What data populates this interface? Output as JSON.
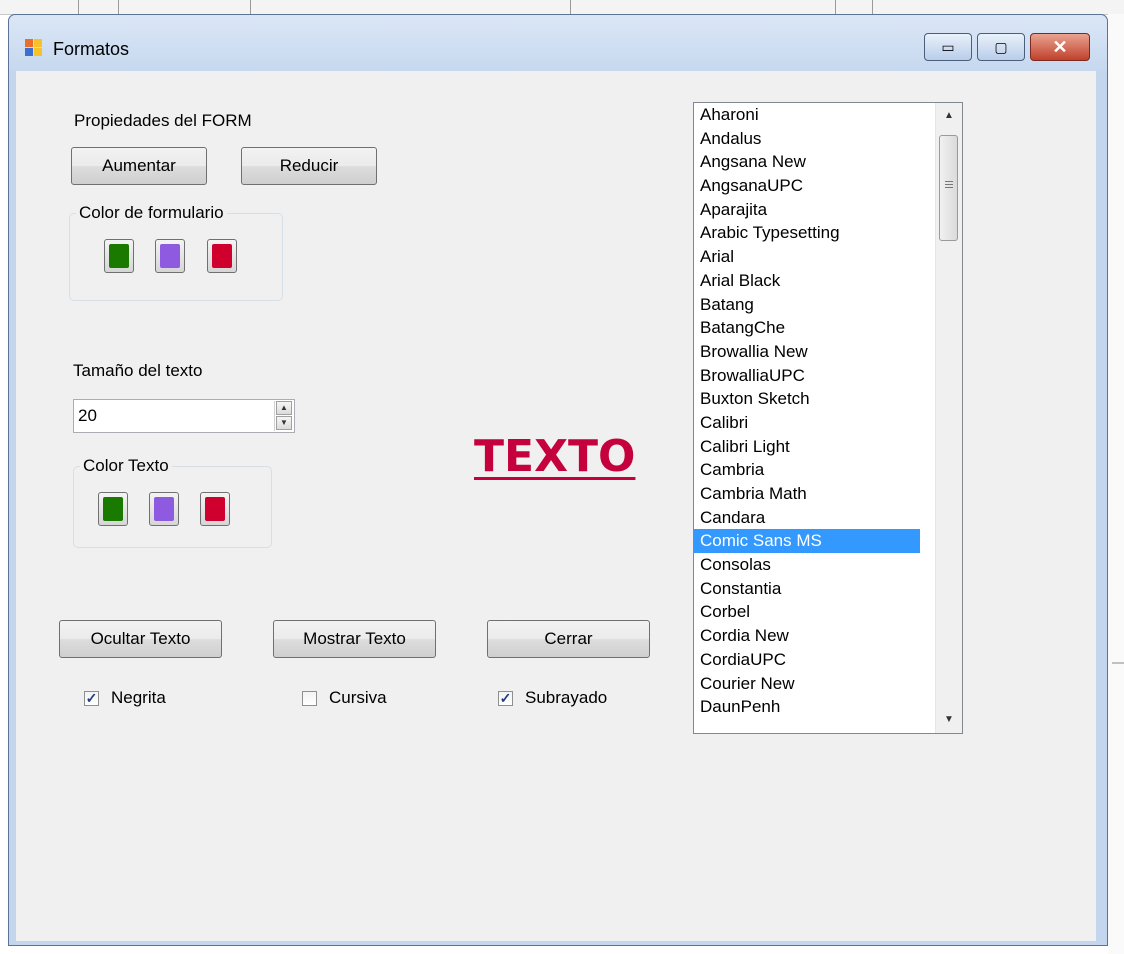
{
  "window": {
    "title": "Formatos",
    "controls": {
      "minimize": "▭",
      "maximize": "▢",
      "close": "✕"
    }
  },
  "form_props": {
    "label": "Propiedades del FORM",
    "increase_button": "Aumentar",
    "reduce_button": "Reducir",
    "color_group_title": "Color de formulario"
  },
  "text_size": {
    "label": "Tamaño del texto",
    "value": "20"
  },
  "text_color": {
    "group_title": "Color Texto"
  },
  "swatches": {
    "green": "#1a7a00",
    "purple": "#8e5ae0",
    "red": "#d0002e"
  },
  "preview": {
    "text": "TEXTO",
    "color": "#c4003d"
  },
  "actions": {
    "hide_text": "Ocultar Texto",
    "show_text": "Mostrar Texto",
    "close": "Cerrar"
  },
  "styles": {
    "bold": {
      "label": "Negrita",
      "checked": true
    },
    "italic": {
      "label": "Cursiva",
      "checked": false
    },
    "underline": {
      "label": "Subrayado",
      "checked": true
    }
  },
  "font_list": {
    "items": [
      "Aharoni",
      "Andalus",
      "Angsana New",
      "AngsanaUPC",
      "Aparajita",
      "Arabic Typesetting",
      "Arial",
      "Arial Black",
      "Batang",
      "BatangChe",
      "Browallia New",
      "BrowalliaUPC",
      "Buxton Sketch",
      "Calibri",
      "Calibri Light",
      "Cambria",
      "Cambria Math",
      "Candara",
      "Comic Sans MS",
      "Consolas",
      "Constantia",
      "Corbel",
      "Cordia New",
      "CordiaUPC",
      "Courier New",
      "DaunPenh"
    ],
    "selected": "Comic Sans MS"
  }
}
